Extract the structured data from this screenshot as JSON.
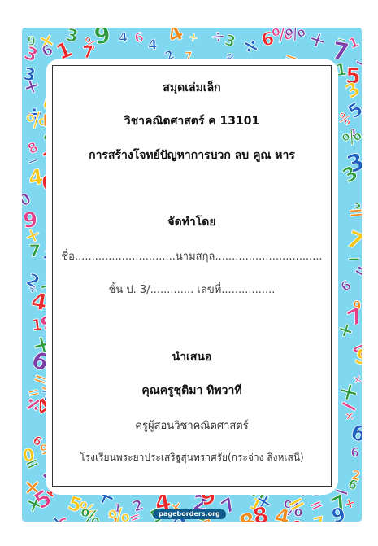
{
  "document": {
    "title": "สมุดเล่มเล็ก",
    "subject": "วิชาคณิตศาสตร์  ค 13101",
    "topic": "การสร้างโจทย์ปัญหาการบวก ลบ คูณ หาร",
    "made_by_heading": "จัดทำโดย",
    "name_line": "ชื่อ..............................นามสกุล................................",
    "class_line": "ชั้น ป. 3/............. เลขที่................",
    "present_heading": "นำเสนอ",
    "teacher_name": "คุณครูชุติมา  ทิพวาที",
    "teacher_role": "ครูผู้สอนวิชาคณิตศาสตร์",
    "school": "โรงเรียนพระยาประเสริฐสุนทราศรัย(กระจ่าง สิงหเสนี)"
  },
  "border": {
    "background_color": "#7fd7f0",
    "number_colors": [
      "#e8282a",
      "#2b9a3a",
      "#f5c518",
      "#7a3ea8",
      "#f08a1c",
      "#e0408a",
      "#1f5fbf"
    ],
    "watermark": "pageborders.org"
  }
}
